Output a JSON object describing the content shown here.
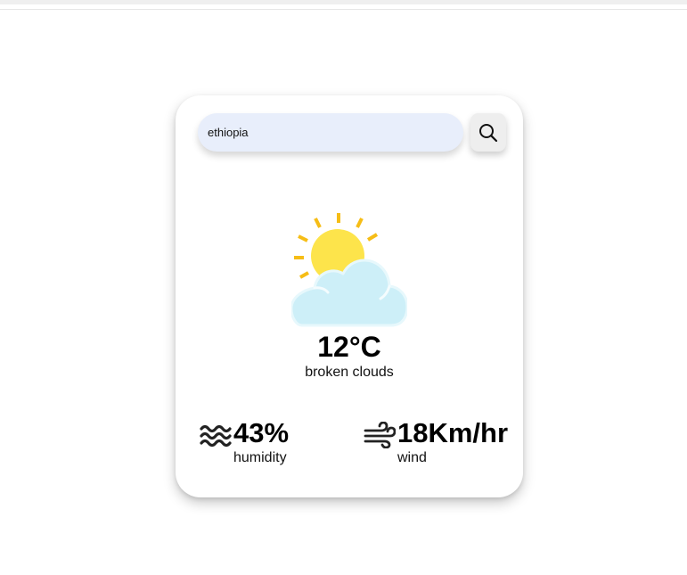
{
  "search": {
    "value": "ethiopia",
    "icon": "search-icon"
  },
  "weather": {
    "icon": "sun-behind-cloud-icon",
    "temperature": "12°C",
    "description": "broken clouds"
  },
  "humidity": {
    "icon": "humidity-waves-icon",
    "value": "43%",
    "label": "humidity"
  },
  "wind": {
    "icon": "wind-icon",
    "value": "18Km/hr",
    "label": "wind"
  },
  "colors": {
    "input_background": "#e8eefb",
    "sun": "#fde44b",
    "sun_rays": "#f6bd16",
    "cloud": "#cdeff8"
  }
}
